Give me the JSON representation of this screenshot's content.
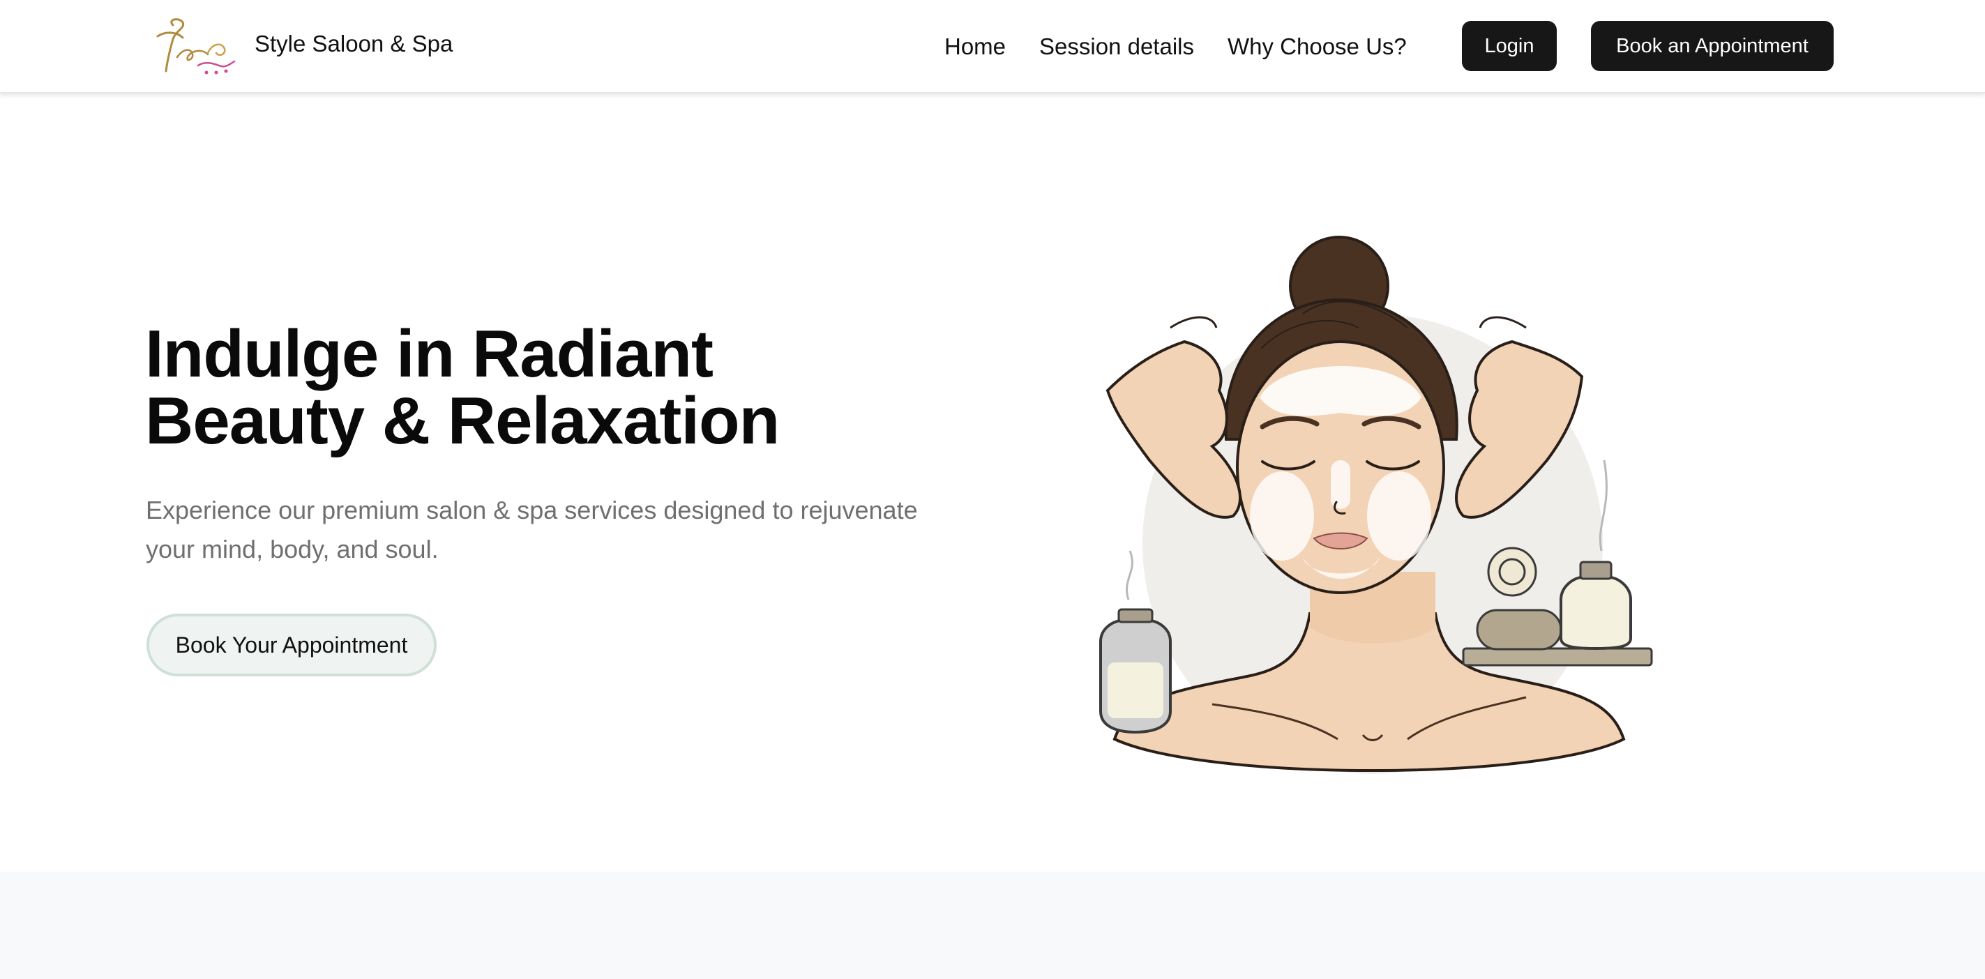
{
  "brand": {
    "name": "Style Saloon & Spa",
    "logo_icon": "salon-logo-icon"
  },
  "nav": {
    "links": [
      "Home",
      "Session details",
      "Why Choose Us?"
    ],
    "login_label": "Login",
    "book_label": "Book an Appointment"
  },
  "hero": {
    "title_line1": "Indulge in Radiant",
    "title_line2": "Beauty & Relaxation",
    "subtitle": "Experience our premium salon & spa services designed to rejuvenate your mind, body, and soul.",
    "cta_label": "Book Your Appointment",
    "illustration_icon": "facial-massage-illustration"
  },
  "colors": {
    "primary_button": "#171717",
    "cta_background": "#eff3f1",
    "cta_border": "#cfe0d6",
    "subtitle_text": "#6f6f6f",
    "skin": "#f2d3b6",
    "hair": "#4a3223",
    "lower_band": "#f8f9fb"
  }
}
